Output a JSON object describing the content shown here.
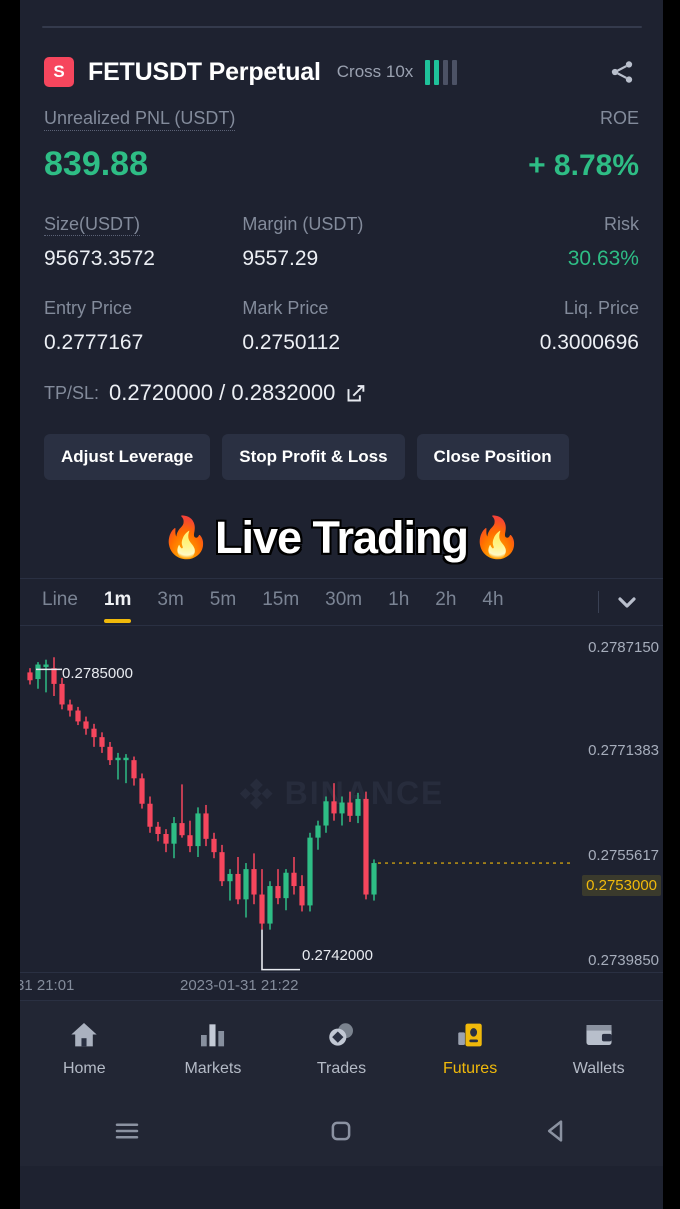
{
  "header": {
    "side_badge": "S",
    "symbol": "FETUSDT Perpetual",
    "margin_mode": "Cross 10x",
    "risk_bars_on": 2,
    "risk_bars_total": 4,
    "share_icon": "share-icon"
  },
  "position": {
    "pnl_label": "Unrealized PNL (USDT)",
    "roe_label": "ROE",
    "pnl_value": "839.88",
    "roe_value": "+ 8.78%",
    "pnl_color": "#2ebd85",
    "size_label": "Size(USDT)",
    "size_value": "95673.3572",
    "margin_label": "Margin (USDT)",
    "margin_value": "9557.29",
    "risk_label": "Risk",
    "risk_value": "30.63%",
    "entry_label": "Entry Price",
    "entry_value": "0.2777167",
    "mark_label": "Mark Price",
    "mark_value": "0.2750112",
    "liq_label": "Liq. Price",
    "liq_value": "0.3000696",
    "tpsl_label": "TP/SL:",
    "tpsl_value": "0.2720000 / 0.2832000",
    "edit_icon": "edit-icon"
  },
  "actions": {
    "adjust_leverage": "Adjust Leverage",
    "stop_profit_loss": "Stop Profit & Loss",
    "close_position": "Close Position"
  },
  "overlay": {
    "fire_left": "🔥",
    "text": "Live Trading",
    "fire_right": "🔥"
  },
  "timeframes": {
    "items": [
      {
        "label": "Line",
        "active": false
      },
      {
        "label": "1m",
        "active": true
      },
      {
        "label": "3m",
        "active": false
      },
      {
        "label": "5m",
        "active": false
      },
      {
        "label": "15m",
        "active": false
      },
      {
        "label": "30m",
        "active": false
      },
      {
        "label": "1h",
        "active": false
      },
      {
        "label": "2h",
        "active": false
      },
      {
        "label": "4h",
        "active": false
      }
    ],
    "caret_icon": "chevron-down-icon",
    "active_color": "#f0b90b"
  },
  "chart_data": {
    "type": "candlestick",
    "title": "FETUSDT Perpetual 1m",
    "watermark": "BINANCE",
    "ylabel": "",
    "xlabel": "",
    "y_ticks": [
      "0.2787150",
      "0.2771383",
      "0.2755617",
      "0.2739850"
    ],
    "ylim": [
      0.2735,
      0.2792
    ],
    "current_price": "0.2753000",
    "current_price_color": "#f0b90b",
    "high_marker": "0.2785000",
    "low_marker": "0.2742000",
    "x_ticks": [
      "31 21:01",
      "2023-01-31 21:22"
    ],
    "up_color": "#2ebd85",
    "down_color": "#f6465d",
    "candles": [
      {
        "o": 0.27845,
        "h": 0.27852,
        "l": 0.27825,
        "c": 0.27832,
        "d": "down"
      },
      {
        "o": 0.27834,
        "h": 0.27862,
        "l": 0.27818,
        "c": 0.27858,
        "d": "up"
      },
      {
        "o": 0.27858,
        "h": 0.27866,
        "l": 0.27812,
        "c": 0.27854,
        "d": "up"
      },
      {
        "o": 0.27852,
        "h": 0.2787,
        "l": 0.27806,
        "c": 0.27826,
        "d": "down"
      },
      {
        "o": 0.27826,
        "h": 0.27836,
        "l": 0.27784,
        "c": 0.27792,
        "d": "down"
      },
      {
        "o": 0.27792,
        "h": 0.278,
        "l": 0.27772,
        "c": 0.27782,
        "d": "down"
      },
      {
        "o": 0.27782,
        "h": 0.27788,
        "l": 0.27758,
        "c": 0.27764,
        "d": "down"
      },
      {
        "o": 0.27764,
        "h": 0.27772,
        "l": 0.27742,
        "c": 0.27752,
        "d": "down"
      },
      {
        "o": 0.27752,
        "h": 0.2776,
        "l": 0.27722,
        "c": 0.27738,
        "d": "down"
      },
      {
        "o": 0.27738,
        "h": 0.27746,
        "l": 0.27712,
        "c": 0.27722,
        "d": "down"
      },
      {
        "o": 0.27722,
        "h": 0.2773,
        "l": 0.27692,
        "c": 0.277,
        "d": "down"
      },
      {
        "o": 0.277,
        "h": 0.27712,
        "l": 0.27668,
        "c": 0.27704,
        "d": "up"
      },
      {
        "o": 0.27704,
        "h": 0.2771,
        "l": 0.27662,
        "c": 0.277,
        "d": "up"
      },
      {
        "o": 0.277,
        "h": 0.27706,
        "l": 0.27658,
        "c": 0.2767,
        "d": "down"
      },
      {
        "o": 0.2767,
        "h": 0.27678,
        "l": 0.2762,
        "c": 0.27628,
        "d": "down"
      },
      {
        "o": 0.27628,
        "h": 0.2764,
        "l": 0.2758,
        "c": 0.2759,
        "d": "down"
      },
      {
        "o": 0.2759,
        "h": 0.27598,
        "l": 0.27566,
        "c": 0.27578,
        "d": "down"
      },
      {
        "o": 0.27578,
        "h": 0.27586,
        "l": 0.27548,
        "c": 0.27562,
        "d": "down"
      },
      {
        "o": 0.27562,
        "h": 0.27606,
        "l": 0.27538,
        "c": 0.27596,
        "d": "up"
      },
      {
        "o": 0.27596,
        "h": 0.2766,
        "l": 0.27572,
        "c": 0.27576,
        "d": "down"
      },
      {
        "o": 0.27576,
        "h": 0.276,
        "l": 0.27548,
        "c": 0.27558,
        "d": "down"
      },
      {
        "o": 0.27558,
        "h": 0.27622,
        "l": 0.2754,
        "c": 0.27612,
        "d": "up"
      },
      {
        "o": 0.27612,
        "h": 0.27626,
        "l": 0.27558,
        "c": 0.2757,
        "d": "down"
      },
      {
        "o": 0.2757,
        "h": 0.2758,
        "l": 0.27538,
        "c": 0.27548,
        "d": "down"
      },
      {
        "o": 0.27548,
        "h": 0.2756,
        "l": 0.27492,
        "c": 0.275,
        "d": "down"
      },
      {
        "o": 0.275,
        "h": 0.2752,
        "l": 0.27468,
        "c": 0.27512,
        "d": "up"
      },
      {
        "o": 0.27512,
        "h": 0.2754,
        "l": 0.27462,
        "c": 0.2747,
        "d": "down"
      },
      {
        "o": 0.2747,
        "h": 0.2753,
        "l": 0.2744,
        "c": 0.2752,
        "d": "up"
      },
      {
        "o": 0.2752,
        "h": 0.27546,
        "l": 0.27462,
        "c": 0.27478,
        "d": "down"
      },
      {
        "o": 0.27478,
        "h": 0.2752,
        "l": 0.2742,
        "c": 0.2743,
        "d": "down"
      },
      {
        "o": 0.2743,
        "h": 0.275,
        "l": 0.2742,
        "c": 0.27492,
        "d": "up"
      },
      {
        "o": 0.27492,
        "h": 0.2752,
        "l": 0.27462,
        "c": 0.27472,
        "d": "down"
      },
      {
        "o": 0.27472,
        "h": 0.2752,
        "l": 0.27452,
        "c": 0.27514,
        "d": "up"
      },
      {
        "o": 0.27514,
        "h": 0.2754,
        "l": 0.27478,
        "c": 0.27492,
        "d": "down"
      },
      {
        "o": 0.27492,
        "h": 0.2751,
        "l": 0.2745,
        "c": 0.2746,
        "d": "down"
      },
      {
        "o": 0.2746,
        "h": 0.2758,
        "l": 0.2745,
        "c": 0.27572,
        "d": "up"
      },
      {
        "o": 0.27572,
        "h": 0.276,
        "l": 0.27552,
        "c": 0.27592,
        "d": "up"
      },
      {
        "o": 0.27592,
        "h": 0.2764,
        "l": 0.2758,
        "c": 0.27632,
        "d": "up"
      },
      {
        "o": 0.27632,
        "h": 0.27662,
        "l": 0.276,
        "c": 0.27612,
        "d": "down"
      },
      {
        "o": 0.27612,
        "h": 0.2764,
        "l": 0.27592,
        "c": 0.2763,
        "d": "up"
      },
      {
        "o": 0.2763,
        "h": 0.27648,
        "l": 0.27598,
        "c": 0.27608,
        "d": "down"
      },
      {
        "o": 0.27608,
        "h": 0.27646,
        "l": 0.27596,
        "c": 0.27636,
        "d": "up"
      },
      {
        "o": 0.27636,
        "h": 0.27648,
        "l": 0.2747,
        "c": 0.27478,
        "d": "down"
      },
      {
        "o": 0.27478,
        "h": 0.27536,
        "l": 0.27468,
        "c": 0.2753,
        "d": "up"
      }
    ]
  },
  "bottom_nav": {
    "items": [
      {
        "label": "Home",
        "icon": "home-icon",
        "active": false
      },
      {
        "label": "Markets",
        "icon": "markets-icon",
        "active": false
      },
      {
        "label": "Trades",
        "icon": "trades-icon",
        "active": false
      },
      {
        "label": "Futures",
        "icon": "futures-icon",
        "active": true
      },
      {
        "label": "Wallets",
        "icon": "wallets-icon",
        "active": false
      }
    ],
    "active_color": "#f0b90b"
  },
  "android_nav": {
    "recents_icon": "recents-menu-icon",
    "home_icon": "home-square-icon",
    "back_icon": "back-triangle-icon"
  }
}
